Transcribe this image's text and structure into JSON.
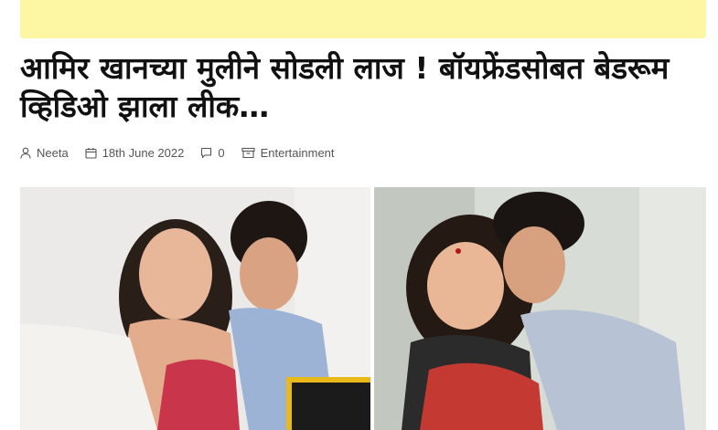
{
  "article": {
    "headline": "आमिर खानच्या मुलीने सोडली लाज ! बॉयफ्रेंडसोबत बेडरूम व्हिडिओ झाला लीक…",
    "author": "Neeta",
    "date": "18th June 2022",
    "comments_count": "0",
    "category": "Entertainment"
  },
  "icons": {
    "author": "user-icon",
    "date": "calendar-icon",
    "comments": "comment-icon",
    "category": "archive-icon"
  },
  "colors": {
    "ad_banner": "#fdf7a3",
    "headline": "#111111",
    "meta_text": "#555555"
  }
}
